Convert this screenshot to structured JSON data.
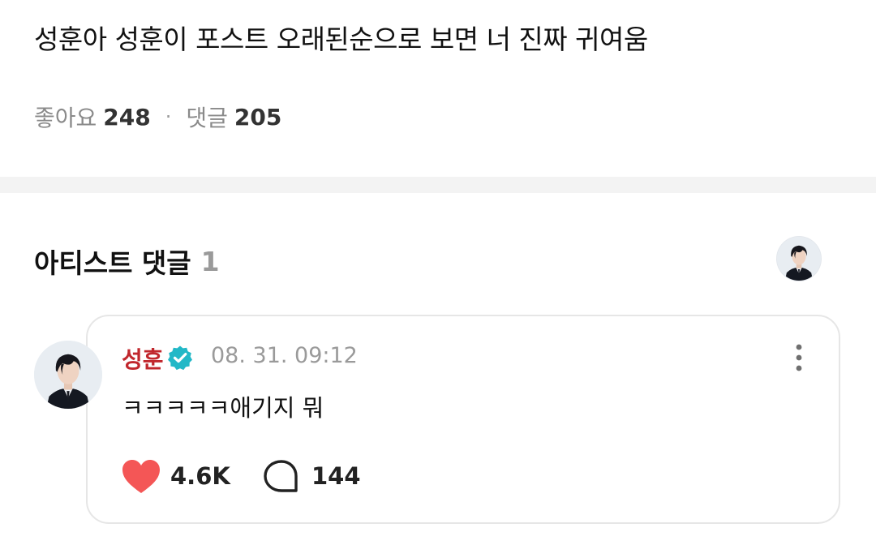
{
  "post": {
    "title": "성훈아 성훈이 포스트 오래된순으로 보면 너 진짜 귀여움",
    "likes_label": "좋아요",
    "likes_count": "248",
    "separator": "·",
    "comments_label": "댓글",
    "comments_count": "205"
  },
  "artist_comments": {
    "title": "아티스트 댓글",
    "count": "1"
  },
  "comment": {
    "author": "성훈",
    "verified_icon": "verified-check-icon",
    "date": "08. 31. 09:12",
    "text": "ㅋㅋㅋㅋㅋ애기지 뭐",
    "likes": "4.6K",
    "replies": "144",
    "more_icon": "more-vertical-icon",
    "heart_icon": "heart-icon",
    "reply_icon": "speech-bubble-icon"
  },
  "colors": {
    "author_name": "#c1272d",
    "heart": "#f45656",
    "verified_badge": "#22b8c7",
    "divider": "#f3f3f3"
  }
}
